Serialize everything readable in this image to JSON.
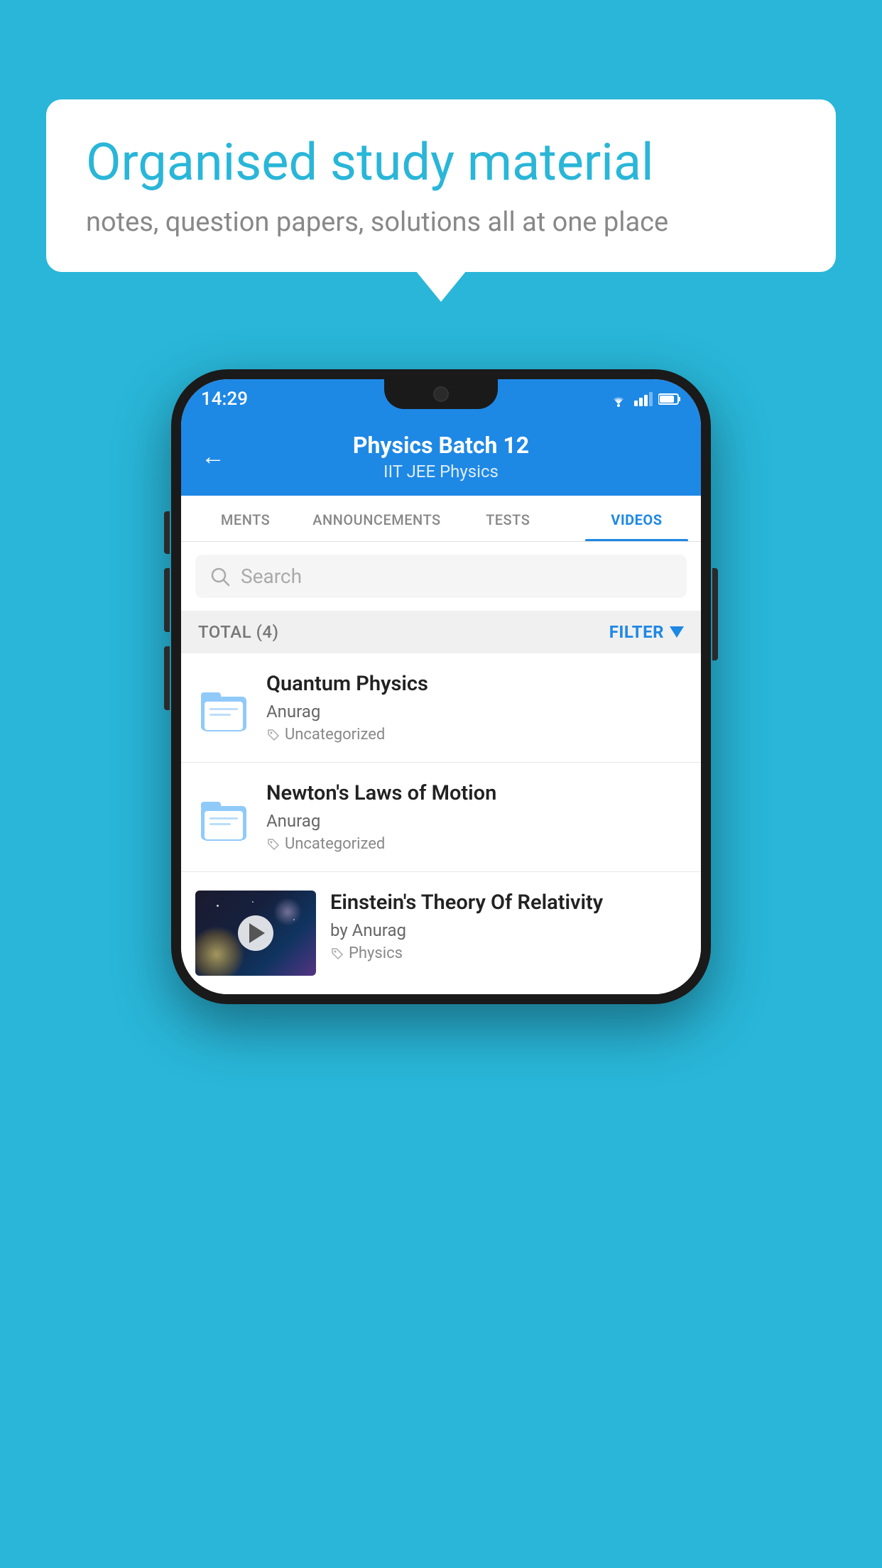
{
  "background_color": "#29B6D8",
  "speech_bubble": {
    "title": "Organised study material",
    "subtitle": "notes, question papers, solutions all at one place"
  },
  "phone": {
    "status_bar": {
      "time": "14:29"
    },
    "header": {
      "title": "Physics Batch 12",
      "subtitle": "IIT JEE   Physics",
      "back_label": "←"
    },
    "tabs": [
      {
        "label": "MENTS",
        "active": false
      },
      {
        "label": "ANNOUNCEMENTS",
        "active": false
      },
      {
        "label": "TESTS",
        "active": false
      },
      {
        "label": "VIDEOS",
        "active": true
      }
    ],
    "search": {
      "placeholder": "Search"
    },
    "filter": {
      "total_label": "TOTAL (4)",
      "filter_label": "FILTER"
    },
    "videos": [
      {
        "title": "Quantum Physics",
        "author": "Anurag",
        "tag": "Uncategorized",
        "type": "folder",
        "has_thumbnail": false
      },
      {
        "title": "Newton's Laws of Motion",
        "author": "Anurag",
        "tag": "Uncategorized",
        "type": "folder",
        "has_thumbnail": false
      },
      {
        "title": "Einstein's Theory Of Relativity",
        "author": "by Anurag",
        "tag": "Physics",
        "type": "video",
        "has_thumbnail": true
      }
    ]
  }
}
